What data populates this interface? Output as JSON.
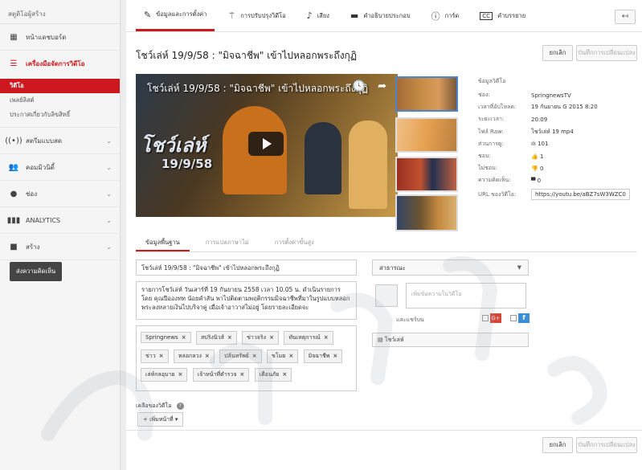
{
  "sidebar": {
    "title": "สตูดิโอผู้สร้าง",
    "items": [
      {
        "label": "หน้าแดชบอร์ด",
        "icon": "dashboard-icon"
      },
      {
        "label": "เครื่องมือจัดการวิดีโอ",
        "icon": "video-manager-icon"
      },
      {
        "label": "สตรีมแบบสด",
        "icon": "live-icon"
      },
      {
        "label": "คอมมิวนิตี้",
        "icon": "community-icon"
      },
      {
        "label": "ช่อง",
        "icon": "channel-icon"
      },
      {
        "label": "ANALYTICS",
        "icon": "analytics-icon"
      },
      {
        "label": "สร้าง",
        "icon": "create-icon"
      }
    ],
    "sub_items": [
      "วิดีโอ",
      "เพลย์ลิสต์",
      "ประกาศเกี่ยวกับลิขสิทธิ์"
    ],
    "feedback": "ส่งความคิดเห็น"
  },
  "tabs": [
    {
      "label": "ข้อมูลและการตั้งค่า",
      "icon": "pencil-icon"
    },
    {
      "label": "การปรับปรุงวิดีโอ",
      "icon": "magic-wand-icon"
    },
    {
      "label": "เสียง",
      "icon": "music-note-icon"
    },
    {
      "label": "คำอธิบายประกอบ",
      "icon": "annotation-icon"
    },
    {
      "label": "การ์ด",
      "icon": "info-icon"
    },
    {
      "label": "คำบรรยาย",
      "icon": "cc-icon"
    }
  ],
  "video": {
    "title": "โชว์เล่ห์ 19/9/58 : \"มิจฉาชีพ\" เข้าไปหลอกพระถึงกุฏิ",
    "logo_text": "โชว์เล่ห์",
    "logo_date": "19/9/58"
  },
  "buttons": {
    "cancel": "ยกเลิก",
    "save": "บันทึกการเปลี่ยนแปลง"
  },
  "info": {
    "header": "ข้อมูลวิดีโอ",
    "rows": [
      {
        "k": "ช่อง:",
        "v": "SpringnewsTV"
      },
      {
        "k": "เวลาที่อัปโหลด:",
        "v": "19 กันยายน G 2015 8:20"
      },
      {
        "k": "ระยะเวลา:",
        "v": "20:09"
      },
      {
        "k": "ไฟล์ Raw:",
        "v": "โชว์เล่ห์ 19 mp4"
      },
      {
        "k": "ส่วนการดู:",
        "v": "101"
      },
      {
        "k": "ชอบ:",
        "v": "1"
      },
      {
        "k": "ไม่ชอบ:",
        "v": "0"
      },
      {
        "k": "ความคิดเห็น:",
        "v": "0"
      }
    ],
    "url_label": "URL ของวิดีโอ:",
    "url": "https://youtu.be/aBZ7sW3WZC0"
  },
  "subtabs": [
    "ข้อมูลพื้นฐาน",
    "การแปลภาษาไม่",
    "การตั้งค่าขั้นสูง"
  ],
  "form": {
    "title": "โชว์เล่ห์ 19/9/58 : \"มิจฉาชีพ\" เข้าไปหลอกพระถึงกุฏิ",
    "description": "รายการโชว์เล่ห์ วันเสาร์ที่ 19 กันยายน 2558 เวลา 10.05 น. ดำเนินรายการโดย คุณปีอองทท น้อยคำสัน พาไปติดตามพฤติกรรมมิจฉาชีพที่มาในรูปแบบหลอกพระลงหลายเงินไปบริจาคู่ เมื่อเจ้าอาวาสไม่อยู่ โดยรายละเอียดจะ",
    "tags_row1": [
      "Springnews",
      "สปริงนิวส์",
      "ข่าวจริง",
      "ทันเหตุการณ์"
    ],
    "tags_row2": [
      "ข่าว",
      "หลอกลวง",
      "ปล้นทรัพย์",
      "ขโมย",
      "มิจฉาชีพ"
    ],
    "tags_row3": [
      "เล่ห์กลอุบาย",
      "เจ้าหน้าที่ตำรวจ",
      "เตือนภัย"
    ],
    "privacy": "สาธารณะ",
    "share_placeholder": "เพิ่มข้อความในวิดีโอ",
    "share_label": "และแชร์บน",
    "gplus": "G+",
    "fb": "f",
    "playlist": "โชว์เล่ห์",
    "vlang_label": "เคลือของวิดีโอ",
    "add_label": "เพิ่มหน้าที่"
  },
  "accent_color": "#cc181e"
}
